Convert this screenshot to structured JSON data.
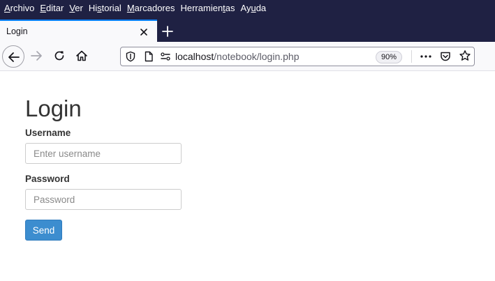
{
  "menubar": {
    "items": [
      {
        "acc": "A",
        "rest": "rchivo"
      },
      {
        "acc": "E",
        "rest": "ditar"
      },
      {
        "acc": "V",
        "rest": "er"
      },
      {
        "pre": "Hi",
        "acc": "s",
        "rest": "torial"
      },
      {
        "acc": "M",
        "rest": "arcadores"
      },
      {
        "pre": "Herramien",
        "acc": "t",
        "rest": "as"
      },
      {
        "pre": "Ay",
        "acc": "u",
        "rest": "da"
      }
    ]
  },
  "tab": {
    "title": "Login"
  },
  "urlbar": {
    "host": "localhost",
    "path": "/notebook/login.php",
    "zoom": "90%"
  },
  "page": {
    "title": "Login",
    "username_label": "Username",
    "username_placeholder": "Enter username",
    "username_value": "",
    "password_label": "Password",
    "password_placeholder": "Password",
    "password_value": "",
    "send_label": "Send"
  },
  "colors": {
    "chrome_dark": "#1f2143",
    "tab_accent": "#0a84ff",
    "button_primary": "#3c8dcf"
  }
}
